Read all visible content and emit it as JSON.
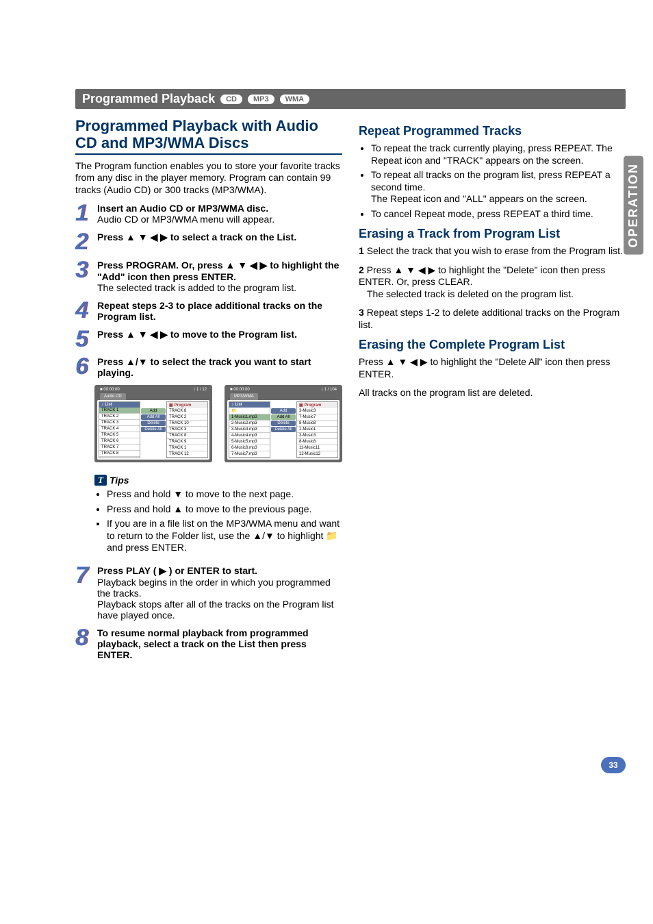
{
  "section": {
    "title": "Programmed Playback",
    "badges": [
      "CD",
      "MP3",
      "WMA"
    ]
  },
  "left": {
    "title": "Programmed Playback with Audio CD and MP3/WMA Discs",
    "intro": "The Program function enables you to store your favorite tracks from any disc in the player memory. Program can contain 99 tracks (Audio CD) or 300 tracks (MP3/WMA).",
    "steps": {
      "1": {
        "bold": "Insert an Audio CD or MP3/WMA disc.",
        "sub": "Audio CD or MP3/WMA menu will appear."
      },
      "2": {
        "bold": "Press ▲ ▼ ◀ ▶ to select a track on the List."
      },
      "3": {
        "bold": "Press PROGRAM. Or, press ▲ ▼ ◀ ▶ to highlight the \"Add\" icon then press ENTER.",
        "sub": "The selected track is added to the program list."
      },
      "4": {
        "bold": "Repeat steps 2-3 to place additional tracks on the Program list."
      },
      "5": {
        "bold": "Press ▲ ▼ ◀ ▶ to move to the Program list."
      },
      "6": {
        "bold": "Press ▲/▼ to select the track you want to start playing."
      },
      "7": {
        "bold": "Press PLAY ( ▶ ) or ENTER to start.",
        "sub1": "Playback begins in the order in which you programmed the tracks.",
        "sub2": "Playback stops after all of the tracks on the Program list have played once."
      },
      "8": {
        "bold": "To resume normal playback from programmed playback, select a track on the List then press ENTER."
      }
    },
    "tips": {
      "head": "Tips",
      "items": [
        "Press and hold ▼ to move to the next page.",
        "Press and hold ▲ to move to the previous page.",
        "If you are in a file list on the MP3/WMA menu and want to return to the Folder list, use the ▲/▼ to highlight 📁 and press ENTER."
      ]
    },
    "screens": {
      "cd": {
        "time": "00:00:00",
        "count": "1 / 12",
        "tab": "Audio CD",
        "list_head": "List",
        "prog_head": "Program",
        "list": [
          "TRACK 1",
          "TRACK 2",
          "TRACK 3",
          "TRACK 4",
          "TRACK 5",
          "TRACK 6",
          "TRACK 7",
          "TRACK 8"
        ],
        "ops": [
          "Add",
          "Add All",
          "Delete",
          "Delete All"
        ],
        "prog": [
          "TRACK 8",
          "TRACK 2",
          "TRACK 10",
          "TRACK 3",
          "TRACK 8",
          "TRACK 9",
          "TRACK 1",
          "TRACK 12"
        ]
      },
      "mp3": {
        "time": "00:00:00",
        "count": "1 / 104",
        "tab": "MP3/WMA",
        "list_head": "List",
        "prog_head": "Program",
        "list": [
          "📁",
          "1-Music1.mp3",
          "2-Music2.mp3",
          "3-Music3.mp3",
          "4-Music4.mp3",
          "5-Music5.mp3",
          "6-Music6.mp3",
          "7-Music7.mp3"
        ],
        "ops": [
          "Add",
          "Add All",
          "Delete",
          "Delete All"
        ],
        "prog": [
          "3-Music3",
          "7-Music7",
          "8-Music8",
          "1-Music1",
          "3-Music3",
          "8-Music8",
          "11-Music11",
          "12-Music12"
        ]
      }
    }
  },
  "right": {
    "repeat": {
      "title": "Repeat Programmed Tracks",
      "items": [
        {
          "main": "To repeat the track currently playing, press REPEAT. The Repeat icon and \"TRACK\" appears on the screen."
        },
        {
          "main": "To repeat all tracks on the program list, press REPEAT a second time.",
          "sub": "The Repeat icon and \"ALL\" appears on the screen."
        },
        {
          "main": "To cancel Repeat mode, press REPEAT a third time."
        }
      ]
    },
    "erase_track": {
      "title": "Erasing a Track from Program List",
      "s1": "Select the track that you wish to erase from the Program list.",
      "s2": "Press ▲ ▼ ◀ ▶ to highlight the \"Delete\" icon then press ENTER. Or, press CLEAR.",
      "s2_sub": "The selected track is deleted on the program list.",
      "s3": "Repeat steps 1-2 to delete additional tracks on the Program list."
    },
    "erase_all": {
      "title": "Erasing the Complete Program List",
      "p1": "Press ▲ ▼ ◀ ▶ to highlight the \"Delete All\" icon then press ENTER.",
      "p2": "All tracks on the program list are deleted."
    }
  },
  "side_tab": "OPERATION",
  "page_number": "33"
}
